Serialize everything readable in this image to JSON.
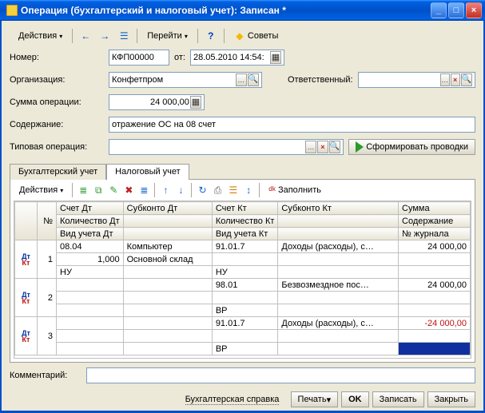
{
  "window": {
    "title": "Операция (бухгалтерский и налоговый учет): Записан *"
  },
  "toolbar": {
    "actions": "Действия",
    "go": "Перейти",
    "advice": "Советы"
  },
  "form": {
    "number_label": "Номер:",
    "number": "КФП00000",
    "date_label": "от:",
    "date": "28.05.2010 14:54:",
    "org_label": "Организация:",
    "org": "Конфетпром",
    "responsible_label": "Ответственный:",
    "responsible": "",
    "sum_label": "Сумма операции:",
    "sum": "24 000,00",
    "content_label": "Содержание:",
    "content": "отражение ОС на 08 счет",
    "typical_label": "Типовая операция:",
    "typical": "",
    "make_postings": "Сформировать проводки",
    "comment_label": "Комментарий:",
    "comment": ""
  },
  "tabs": {
    "bu": "Бухгалтерский учет",
    "nu": "Налоговый учет"
  },
  "grid_toolbar": {
    "actions": "Действия",
    "fill": "Заполнить"
  },
  "grid": {
    "headers": {
      "num": "№",
      "acc_dt": "Счет Дт",
      "sub_dt": "Субконто Дт",
      "acc_kt": "Счет Кт",
      "sub_kt": "Субконто Кт",
      "sum": "Сумма",
      "qty_dt": "Количество Дт",
      "qty_kt": "Количество Кт",
      "content": "Содержание",
      "view_dt": "Вид учета Дт",
      "view_kt": "Вид учета Кт",
      "journal": "№ журнала"
    },
    "rows": [
      {
        "n": "1",
        "acc_dt": "08.04",
        "sub_dt1": "Компьютер",
        "acc_kt": "91.01.7",
        "sub_kt1": "Доходы (расходы), с…",
        "sum": "24 000,00",
        "neg": false,
        "qty_dt": "1,000",
        "sub_dt2": "Основной склад",
        "view_dt": "НУ",
        "view_kt": "НУ"
      },
      {
        "n": "2",
        "acc_dt": "",
        "sub_dt1": "",
        "acc_kt": "98.01",
        "sub_kt1": "Безвозмездное пос…",
        "sum": "24 000,00",
        "neg": false,
        "qty_dt": "",
        "sub_dt2": "",
        "view_dt": "",
        "view_kt": "ВР"
      },
      {
        "n": "3",
        "acc_dt": "",
        "sub_dt1": "",
        "acc_kt": "91.01.7",
        "sub_kt1": "Доходы (расходы), с…",
        "sum": "-24 000,00",
        "neg": true,
        "qty_dt": "",
        "sub_dt2": "",
        "view_dt": "",
        "view_kt": "ВР"
      }
    ]
  },
  "footer": {
    "report": "Бухгалтерская справка",
    "print": "Печать",
    "ok": "OK",
    "save": "Записать",
    "close": "Закрыть"
  }
}
